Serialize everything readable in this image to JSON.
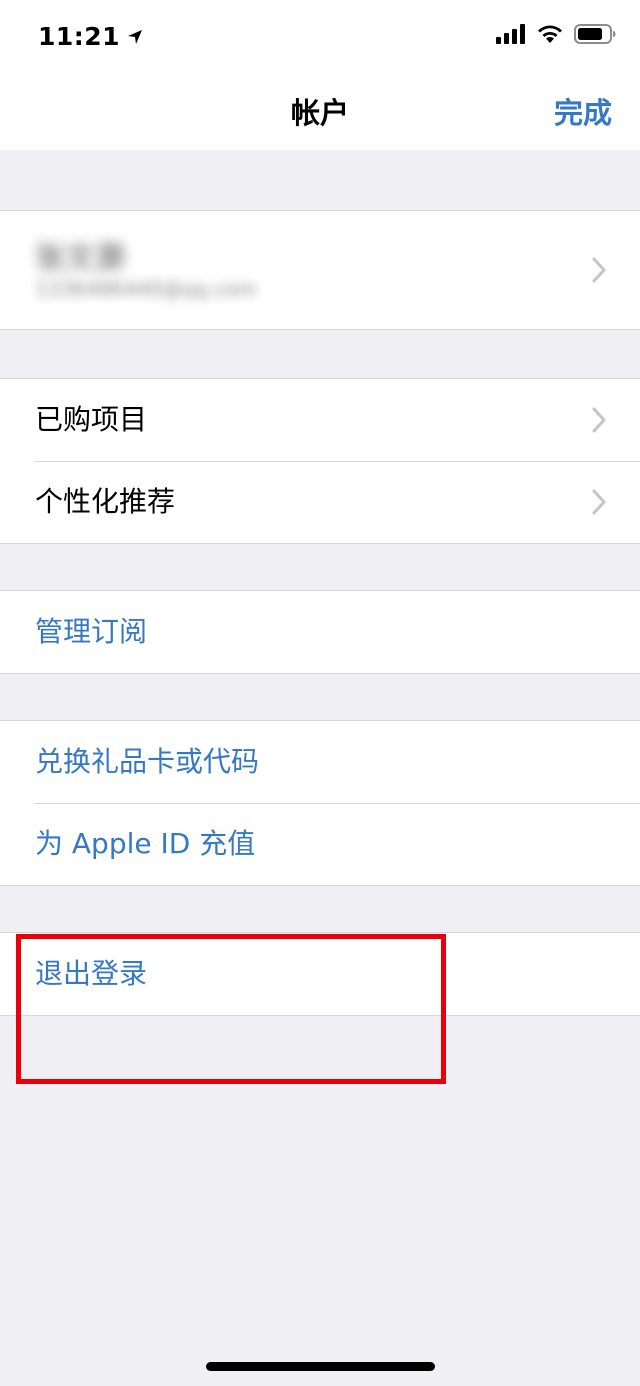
{
  "status_bar": {
    "time": "11:21",
    "icons": [
      "location-arrow-icon",
      "cellular-signal-icon",
      "wifi-icon",
      "battery-icon"
    ]
  },
  "nav": {
    "title": "帐户",
    "done_label": "完成"
  },
  "account": {
    "name": "张文灏",
    "email": "1336486440@qq.com"
  },
  "sections": {
    "purchases": {
      "items": [
        {
          "label": "已购项目"
        },
        {
          "label": "个性化推荐"
        }
      ]
    },
    "subscriptions": {
      "items": [
        {
          "label": "管理订阅"
        }
      ]
    },
    "gift": {
      "items": [
        {
          "label": "兑换礼品卡或代码"
        },
        {
          "label": "为 Apple ID 充值"
        }
      ]
    },
    "signout": {
      "items": [
        {
          "label": "退出登录"
        }
      ]
    }
  },
  "colors": {
    "accent": "#3478c6",
    "background": "#efeff4",
    "highlight": "#e8000b"
  }
}
